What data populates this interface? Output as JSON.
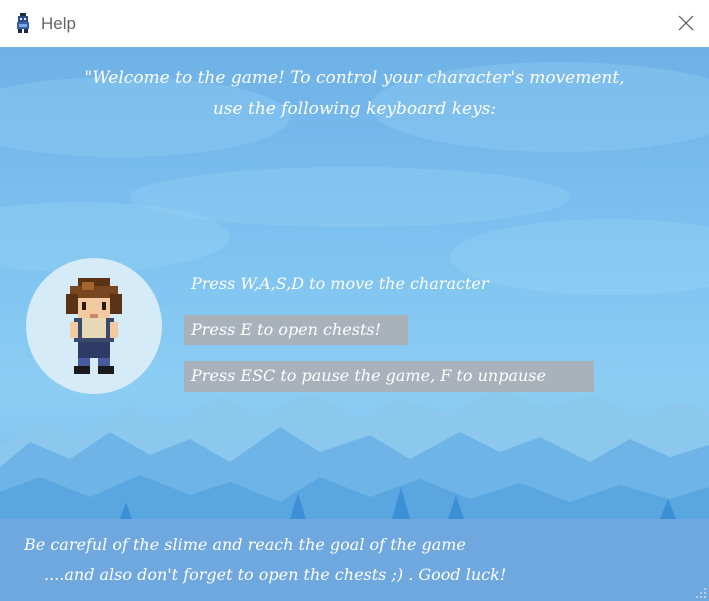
{
  "window": {
    "title": "Help",
    "icons": {
      "app": "app-icon",
      "close": "close-icon"
    }
  },
  "welcome": {
    "line1": "\"Welcome to the game! To control your character's movement,",
    "line2": "use the following keyboard keys:"
  },
  "instructions": [
    "Press W,A,S,D to move the character",
    "Press E to open chests!",
    "Press ESC to pause the game, F to unpause"
  ],
  "footer": {
    "line1": "Be careful of the slime and reach the goal of the game",
    "line2": "....and also don't forget to open the chests ;) . Good luck!"
  },
  "colors": {
    "sky": "#7cc0ec",
    "highlight": "#a9b2bb",
    "footer": "#6fa8de"
  }
}
